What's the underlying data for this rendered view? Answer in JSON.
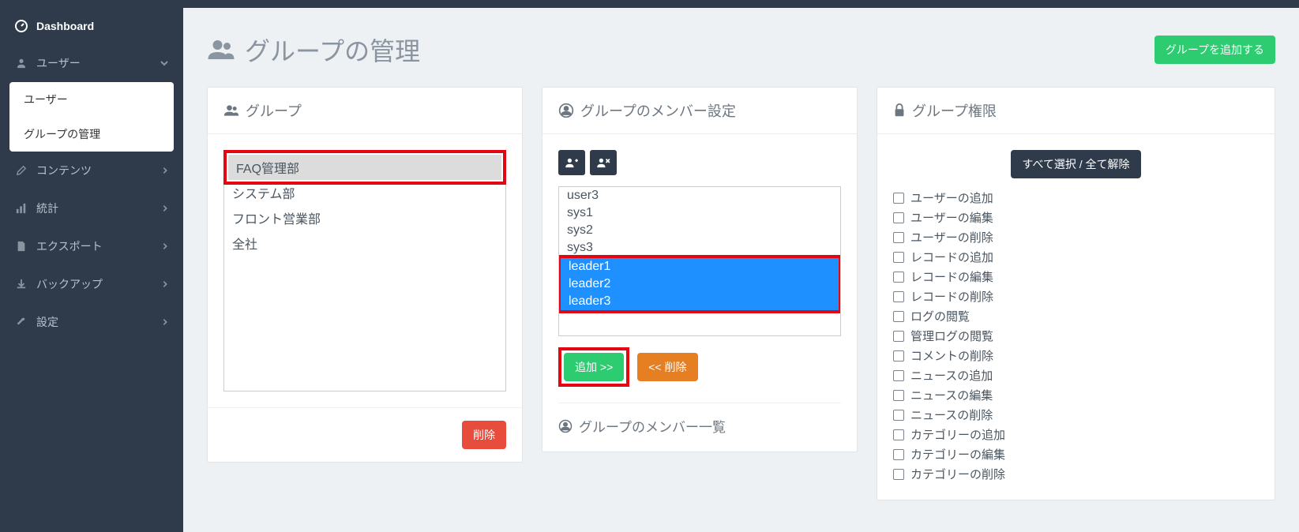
{
  "sidebar": {
    "dashboard": "Dashboard",
    "items": [
      {
        "label": "ユーザー",
        "expanded": true,
        "children": [
          "ユーザー",
          "グループの管理"
        ]
      },
      {
        "label": "コンテンツ"
      },
      {
        "label": "統計"
      },
      {
        "label": "エクスポート"
      },
      {
        "label": "バックアップ"
      },
      {
        "label": "設定"
      }
    ]
  },
  "page": {
    "title": "グループの管理",
    "add_group_btn": "グループを追加する"
  },
  "groups_card": {
    "title": "グループ",
    "options": [
      "FAQ管理部",
      "システム部",
      "フロント営業部",
      "全社"
    ],
    "selected_index": 0,
    "delete_btn": "削除"
  },
  "members_card": {
    "title": "グループのメンバー設定",
    "available": [
      "user3",
      "sys1",
      "sys2",
      "sys3",
      "leader1",
      "leader2",
      "leader3"
    ],
    "selected_indices": [
      4,
      5,
      6
    ],
    "add_btn": "追加 >>",
    "remove_btn": "<< 削除",
    "list_title": "グループのメンバー一覧"
  },
  "perm_card": {
    "title": "グループ権限",
    "select_all_btn": "すべて選択 / 全て解除",
    "items": [
      "ユーザーの追加",
      "ユーザーの編集",
      "ユーザーの削除",
      "レコードの追加",
      "レコードの編集",
      "レコードの削除",
      "ログの閲覧",
      "管理ログの閲覧",
      "コメントの削除",
      "ニュースの追加",
      "ニュースの編集",
      "ニュースの削除",
      "カテゴリーの追加",
      "カテゴリーの編集",
      "カテゴリーの削除"
    ]
  }
}
